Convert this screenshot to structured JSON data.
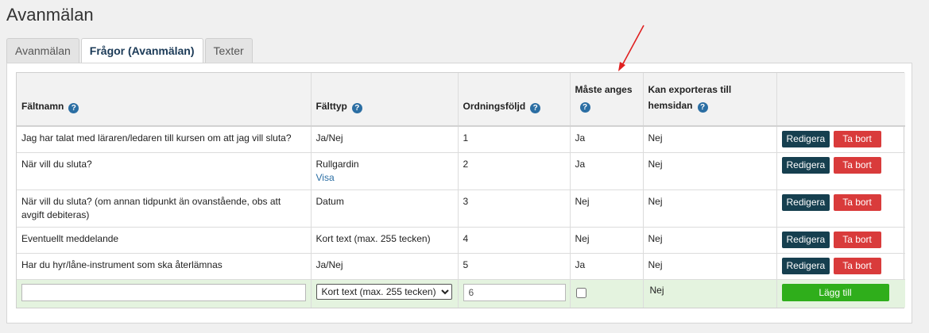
{
  "page": {
    "title": "Avanmälan"
  },
  "tabs": [
    {
      "label": "Avanmälan",
      "active": false
    },
    {
      "label": "Frågor (Avanmälan)",
      "active": true
    },
    {
      "label": "Texter",
      "active": false
    }
  ],
  "table": {
    "columns": [
      {
        "label": "Fältnamn",
        "help": "?"
      },
      {
        "label": "Fälttyp",
        "help": "?"
      },
      {
        "label": "Ordningsföljd",
        "help": "?"
      },
      {
        "label": "Måste anges",
        "help": "?"
      },
      {
        "label": "Kan exporteras till hemsidan",
        "help": "?"
      },
      {
        "label": ""
      }
    ],
    "rows": [
      {
        "name": "Jag har talat med läraren/ledaren till kursen om att jag vill sluta?",
        "type": "Ja/Nej",
        "type_link": "",
        "order": "1",
        "required": "Ja",
        "export": "Nej"
      },
      {
        "name": "När vill du sluta?",
        "type": "Rullgardin",
        "type_link": "Visa",
        "order": "2",
        "required": "Ja",
        "export": "Nej"
      },
      {
        "name": "När vill du sluta? (om annan tidpunkt än ovanstående, obs att avgift debiteras)",
        "type": "Datum",
        "type_link": "",
        "order": "3",
        "required": "Nej",
        "export": "Nej"
      },
      {
        "name": "Eventuellt meddelande",
        "type": "Kort text (max. 255 tecken)",
        "type_link": "",
        "order": "4",
        "required": "Nej",
        "export": "Nej"
      },
      {
        "name": "Har du hyr/låne-instrument som ska återlämnas",
        "type": "Ja/Nej",
        "type_link": "",
        "order": "5",
        "required": "Ja",
        "export": "Nej"
      }
    ],
    "edit_label": "Redigera",
    "delete_label": "Ta bort"
  },
  "add_row": {
    "name_value": "",
    "type_selected": "Kort text (max. 255 tecken)",
    "order_value": "6",
    "required_checked": false,
    "export_value": "Nej",
    "add_label": "Lägg till"
  },
  "colors": {
    "edit_button": "#163f4f",
    "delete_button": "#d93b3b",
    "add_button": "#2fae1b",
    "add_row_bg": "#e4f3df",
    "help_icon": "#2b6ea3",
    "annotation_arrow": "#e02020"
  },
  "icons": {
    "help": "question-circle-icon",
    "annotation": "red-arrow-annotation"
  }
}
